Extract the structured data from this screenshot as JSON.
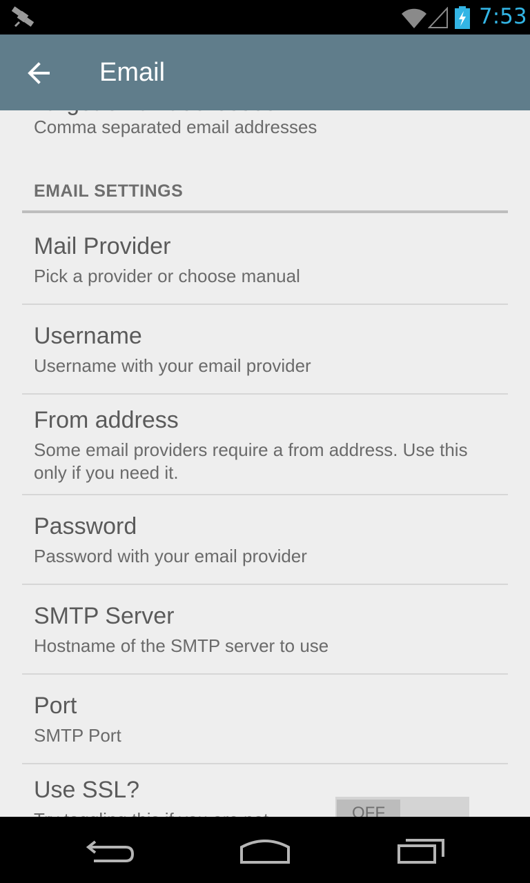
{
  "status_bar": {
    "time": "7:53",
    "icons": [
      "satellite-icon",
      "wifi-icon",
      "signal-icon",
      "battery-charging-icon"
    ]
  },
  "action_bar": {
    "title": "Email",
    "back_icon": "arrow-left-icon"
  },
  "prefs": {
    "target": {
      "title": "Target email addresses",
      "summary": "Comma separated email addresses"
    },
    "category": "EMAIL SETTINGS",
    "mail_provider": {
      "title": "Mail Provider",
      "summary": "Pick a provider or choose manual"
    },
    "username": {
      "title": "Username",
      "summary": "Username with your email provider"
    },
    "from_address": {
      "title": "From address",
      "summary": "Some email providers require a from address. Use this only if you need it."
    },
    "password": {
      "title": "Password",
      "summary": "Password with your email provider"
    },
    "smtp_server": {
      "title": "SMTP Server",
      "summary": "Hostname of the SMTP server to use"
    },
    "port": {
      "title": "Port",
      "summary": "SMTP Port"
    },
    "use_ssl": {
      "title": "Use SSL?",
      "summary": "Try toggling this if you are not",
      "switch_label": "OFF",
      "switch_on": false
    }
  },
  "nav_bar": {
    "icons": [
      "back-nav-icon",
      "home-nav-icon",
      "recents-nav-icon"
    ]
  },
  "colors": {
    "action_bar": "#607d8b",
    "clock": "#33b5e5",
    "background": "#eeeeee"
  }
}
